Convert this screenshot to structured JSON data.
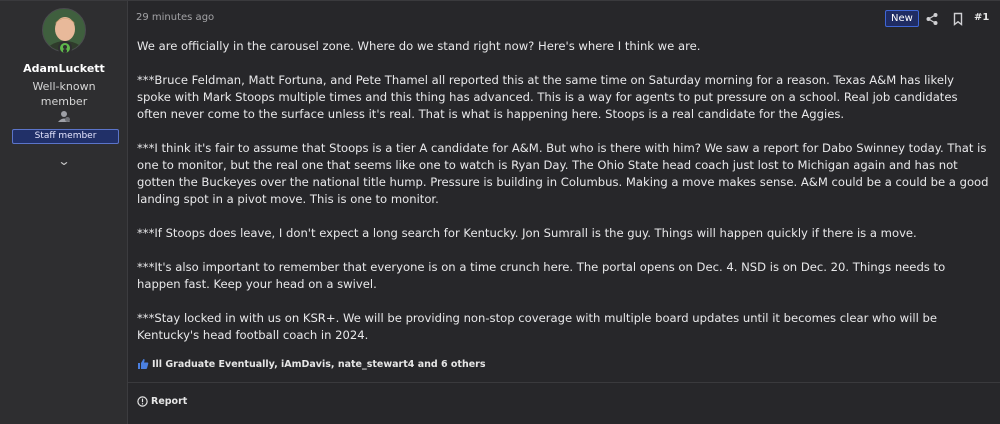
{
  "user": {
    "name": "AdamLuckett",
    "title": "Well-known member",
    "staff_badge": "Staff member"
  },
  "post": {
    "timestamp": "29 minutes ago",
    "new_badge": "New",
    "number": "#1",
    "paragraphs": [
      "We are officially in the carousel zone. Where do we stand right now? Here's where I think we are.",
      "***Bruce Feldman, Matt Fortuna, and Pete Thamel all reported this at the same time on Saturday morning for a reason. Texas A&M has likely spoke with Mark Stoops multiple times and this thing has advanced. This is a way for agents to put pressure on a school. Real job candidates often never come to the surface unless it's real. That is what is happening here. Stoops is a real candidate for the Aggies.",
      "***I think it's fair to assume that Stoops is a tier A candidate for A&M. But who is there with him? We saw a report for Dabo Swinney today. That is one to monitor, but the real one that seems like one to watch is Ryan Day. The Ohio State head coach just lost to Michigan again and has not gotten the Buckeyes over the national title hump. Pressure is building in Columbus. Making a move makes sense. A&M could be a could be a good landing spot in a pivot move. This is one to monitor.",
      "***If Stoops does leave, I don't expect a long search for Kentucky. Jon Sumrall is the guy. Things will happen quickly if there is a move.",
      "***It's also important to remember that everyone is on a time crunch here. The portal opens on Dec. 4. NSD is on Dec. 20. Things needs to happen fast. Keep your head on a swivel.",
      "***Stay locked in with us on KSR+. We will be providing non-stop coverage with multiple board updates until it becomes clear who will be Kentucky's head football coach in 2024."
    ],
    "reactions": "Ill Graduate Eventually, iAmDavis, nate_stewart4 and 6 others",
    "report_label": "Report"
  },
  "colors": {
    "accent": "#3f66d6",
    "like": "#4a7fe0",
    "online": "#5eb84a"
  }
}
